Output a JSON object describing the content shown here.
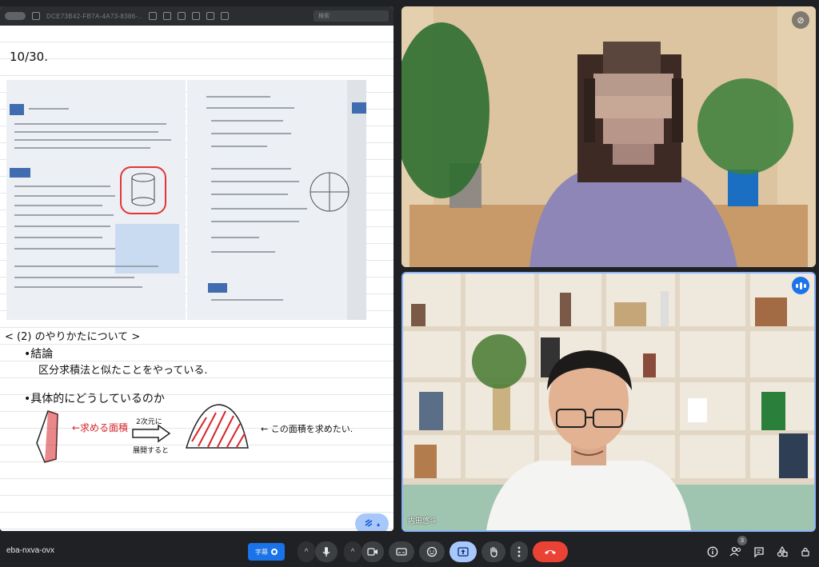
{
  "share": {
    "doc_title": "DCE73B42-FB7A-4A73-8386-...",
    "search_placeholder": "検索",
    "note": {
      "date": "10/30.",
      "section_heading": "< (2) のやりかたについて >",
      "bullet_conclusion_title": "•結論",
      "bullet_conclusion_detail": "区分求積法と似たことをやっている.",
      "bullet_specific_title": "•具体的にどうしているのか",
      "diagram_red_label": "←求める面積",
      "diagram_arrow_top": "2次元に",
      "diagram_arrow_bottom": "展開すると",
      "diagram_right_note": "← この面積を求めたい."
    },
    "fab_expand_symbol": "▴"
  },
  "tiles": {
    "top": {
      "mute_symbol": "⊘"
    },
    "bottom": {
      "participant_name": "内田悠斗"
    }
  },
  "bottom_bar": {
    "meeting_code": "eba-nxva-ovx",
    "rec_label": "字幕",
    "chevron": "^",
    "people_count": "3",
    "colors": {
      "end_call": "#ea4335",
      "present_active": "#a8c7fa",
      "speaking": "#1a73e8"
    }
  },
  "icons": [
    "mic-icon",
    "camera-icon",
    "captions-icon",
    "emoji-icon",
    "present-icon",
    "raise-hand-icon",
    "more-options-icon",
    "end-call-icon",
    "info-icon",
    "people-icon",
    "chat-icon",
    "activities-icon",
    "host-controls-icon"
  ]
}
